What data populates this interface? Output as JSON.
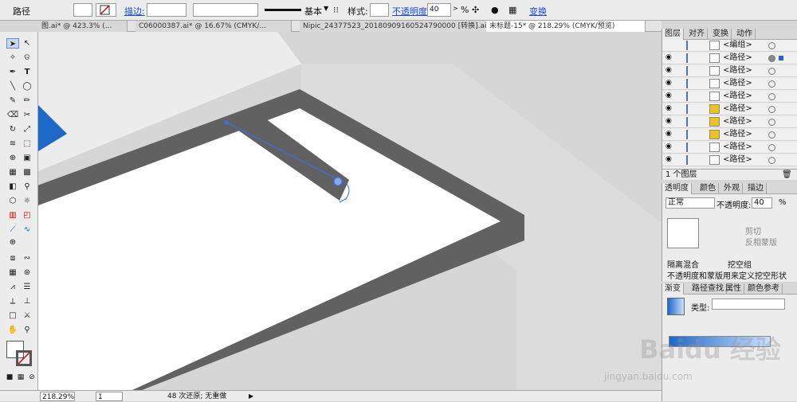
{
  "control_bar": {
    "object_type": "路径",
    "stroke_label": "描边:",
    "stroke_style": "基本",
    "style_label": "样式:",
    "opacity_label": "不透明度",
    "opacity_value": "40",
    "percent": "%",
    "transform_link": "变换"
  },
  "tabs": [
    {
      "label": "图.ai* @ 423.3% (..."
    },
    {
      "label": "C06000387.ai* @ 16.67% (CMYK/..."
    },
    {
      "label": "Nipic_24377523_20180909160524790000 [转换].ai* ..."
    },
    {
      "label": "未标题-15* @ 218.29% (CMYK/预览)"
    }
  ],
  "status": {
    "zoom": "218.29%",
    "page": "1",
    "undo_text": "48 次还原; 无重做"
  },
  "layers_panel": {
    "tabs": [
      "图层",
      "对齐",
      "变换",
      "动作"
    ],
    "rows": [
      {
        "name": "<编组>"
      },
      {
        "name": "<路径>"
      },
      {
        "name": "<路径>"
      },
      {
        "name": "<路径>"
      },
      {
        "name": "<路径>"
      },
      {
        "name": "<路径>"
      },
      {
        "name": "<路径>"
      },
      {
        "name": "<路径>"
      },
      {
        "name": "<路径>"
      },
      {
        "name": "<路径>"
      }
    ],
    "footer": "1 个图层"
  },
  "transparency_panel": {
    "tabs": [
      "透明度",
      "颜色",
      "外观",
      "描边"
    ],
    "blend_mode": "正常",
    "opacity_label": "不透明度:",
    "opacity_value": "40",
    "percent": "%",
    "clip_label": "剪切",
    "invert_mask_label": "反相蒙版",
    "isolate_blend_label": "隔离混合",
    "knockout_group_label": "挖空组",
    "opacity_mask_label": "不透明度和蒙版用来定义挖空形状"
  },
  "gradient_panel": {
    "tabs": [
      "渐变",
      "路径查找",
      "属性",
      "颜色参考"
    ],
    "type_label": "类型:"
  },
  "watermark": {
    "brand": "Baidu 经验",
    "url": "jingyan.baidu.com"
  },
  "colors": {
    "shape_dark": "#626162",
    "shape_light": "#dcdcdd",
    "shape_white": "#ffffff",
    "accent_blue": "#1e68c8",
    "selection_blue": "#3a6ff0"
  }
}
